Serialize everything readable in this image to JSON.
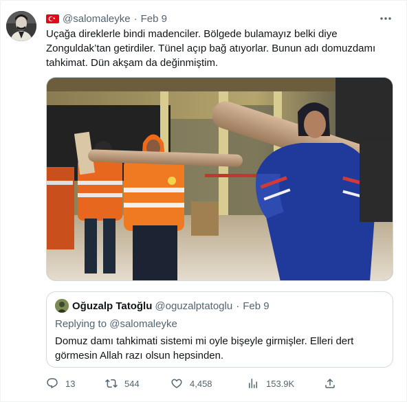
{
  "tweet": {
    "display_name": "",
    "handle": "@salomaleyke",
    "separator": "·",
    "date": "Feb 9",
    "text": "Uçağa direklerle bindi madenciler. Bölgede bulamayız belki diye Zonguldak’tan getirdiler. Tünel açıp bağ atıyorlar. Bunun adı domuzdamı tahkimat. Dün akşam da değinmiştim.",
    "media_alt": "Miners in orange high-visibility workwear carrying wooden log poles inside an airport terminal"
  },
  "quote": {
    "name": "Oğuzalp Tatoğlu",
    "handle": "@oguzalptatoglu",
    "separator": "·",
    "date": "Feb 9",
    "replying_prefix": "Replying to ",
    "replying_to": "@salomaleyke",
    "text": "Domuz damı tahkimati  sistemi mi oyle bişeyle girmişler. Elleri dert görmesin Allah razı olsun hepsinden."
  },
  "actions": {
    "replies": "13",
    "retweets": "544",
    "likes": "4,458",
    "views": "153.9K"
  },
  "icons": {
    "more": "more-icon",
    "reply": "reply-icon",
    "retweet": "retweet-icon",
    "like": "heart-icon",
    "views": "views-icon",
    "share": "share-icon",
    "flag": "turkey-flag-icon"
  },
  "colors": {
    "secondary_text": "#536471",
    "primary_text": "#0f1419",
    "border": "#cfd9de",
    "flag_red": "#e30a17"
  }
}
